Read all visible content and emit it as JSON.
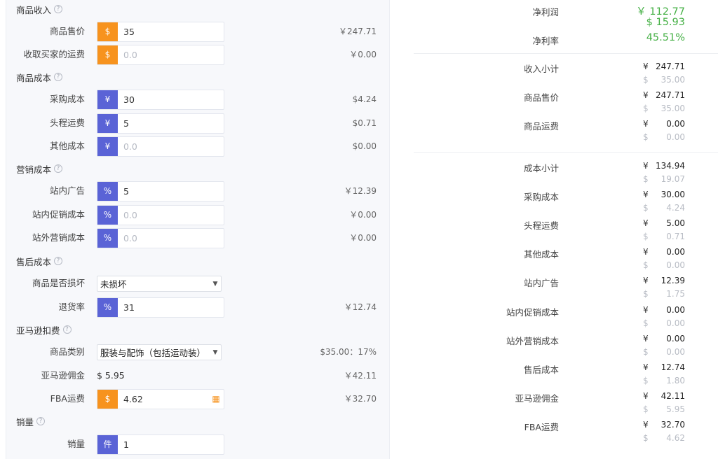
{
  "left": {
    "sections": {
      "income": "商品收入",
      "cost": "商品成本",
      "marketing": "营销成本",
      "aftersale": "售后成本",
      "amazon": "亚马逊扣费",
      "sales": "销量"
    },
    "help_glyph": "?",
    "rows": {
      "price": {
        "label": "商品售价",
        "tag": "$",
        "value": "35",
        "amount": "￥247.71"
      },
      "shipping_income": {
        "label": "收取买家的运费",
        "tag": "$",
        "placeholder": "0.0",
        "amount": "￥0.00"
      },
      "purchase": {
        "label": "采购成本",
        "tag": "¥",
        "value": "30",
        "amount": "$4.24"
      },
      "headhaul": {
        "label": "头程运费",
        "tag": "¥",
        "value": "5",
        "amount": "$0.71"
      },
      "other": {
        "label": "其他成本",
        "tag": "¥",
        "placeholder": "0.0",
        "amount": "$0.00"
      },
      "ads": {
        "label": "站内广告",
        "tag": "%",
        "value": "5",
        "amount": "￥12.39"
      },
      "promo": {
        "label": "站内促销成本",
        "tag": "%",
        "placeholder": "0.0",
        "amount": "￥0.00"
      },
      "offsite": {
        "label": "站外营销成本",
        "tag": "%",
        "placeholder": "0.0",
        "amount": "￥0.00"
      },
      "damaged": {
        "label": "商品是否损坏",
        "selected": "未损坏"
      },
      "return_rate": {
        "label": "退货率",
        "tag": "%",
        "value": "31",
        "amount": "￥12.74"
      },
      "category": {
        "label": "商品类别",
        "selected": "服装与配饰（包括运动装）",
        "amount": "$35.00：17%"
      },
      "commission": {
        "label": "亚马逊佣金",
        "value": "$ 5.95",
        "amount": "￥42.11"
      },
      "fba": {
        "label": "FBA运费",
        "tag": "$",
        "value": "4.62",
        "amount": "￥32.70"
      },
      "qty": {
        "label": "销量",
        "tag": "件",
        "value": "1"
      }
    }
  },
  "right": {
    "net_profit": {
      "label": "净利润",
      "cny": "￥ 112.77",
      "usd": "$  15.93"
    },
    "net_margin": {
      "label": "净利率",
      "value": "45.51%"
    },
    "items": [
      {
        "label": "收入小计",
        "cny": "247.71",
        "usd": "35.00"
      },
      {
        "label": "商品售价",
        "cny": "247.71",
        "usd": "35.00"
      },
      {
        "label": "商品运费",
        "cny": "0.00",
        "usd": "0.00"
      },
      {
        "label": "成本小计",
        "cny": "134.94",
        "usd": "19.07"
      },
      {
        "label": "采购成本",
        "cny": "30.00",
        "usd": "4.24"
      },
      {
        "label": "头程运费",
        "cny": "5.00",
        "usd": "0.71"
      },
      {
        "label": "其他成本",
        "cny": "0.00",
        "usd": "0.00"
      },
      {
        "label": "站内广告",
        "cny": "12.39",
        "usd": "1.75"
      },
      {
        "label": "站内促销成本",
        "cny": "0.00",
        "usd": "0.00"
      },
      {
        "label": "站外营销成本",
        "cny": "0.00",
        "usd": "0.00"
      },
      {
        "label": "售后成本",
        "cny": "12.74",
        "usd": "1.80"
      },
      {
        "label": "亚马逊佣金",
        "cny": "42.11",
        "usd": "5.95"
      },
      {
        "label": "FBA运费",
        "cny": "32.70",
        "usd": "4.62"
      }
    ],
    "cny_symbol": "¥",
    "usd_symbol": "$"
  },
  "icons": {
    "calculator": "calculator-icon",
    "dropdown": "chevron-down-icon"
  },
  "colors": {
    "orange": "#f7931e",
    "blue": "#5a63d6",
    "green": "#45b045"
  }
}
